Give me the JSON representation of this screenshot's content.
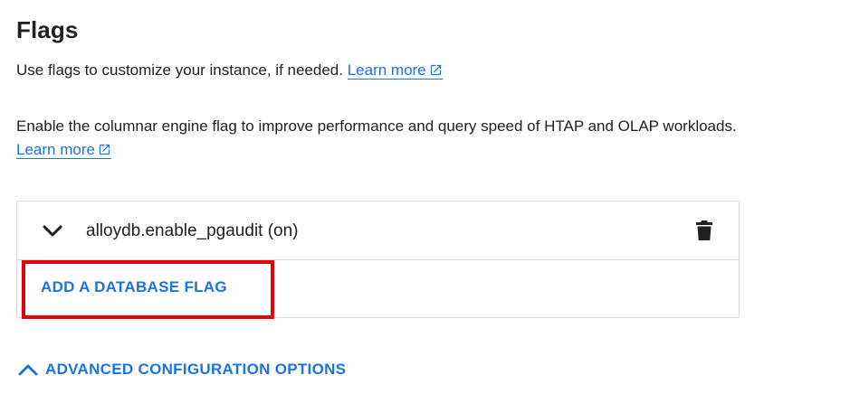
{
  "section": {
    "title": "Flags",
    "description_prefix": "Use flags to customize your instance, if needed.",
    "learn_more_label": "Learn more",
    "columnar_prefix": "Enable the columnar engine flag to improve performance and query speed of HTAP and OLAP workloads.",
    "columnar_learn_more_label": "Learn more"
  },
  "flags": {
    "items": [
      {
        "label": "alloydb.enable_pgaudit (on)",
        "expanded": false
      }
    ],
    "add_button_label": "ADD A DATABASE FLAG"
  },
  "advanced": {
    "label": "ADVANCED CONFIGURATION OPTIONS"
  },
  "icons": {
    "external_link": "open-in-new-icon",
    "expand": "chevron-down-icon",
    "delete": "trash-icon",
    "collapse": "chevron-up-icon"
  },
  "colors": {
    "accent": "#1a73e8",
    "text": "#202124",
    "border": "#dadce0",
    "highlight": "#e8000b"
  }
}
